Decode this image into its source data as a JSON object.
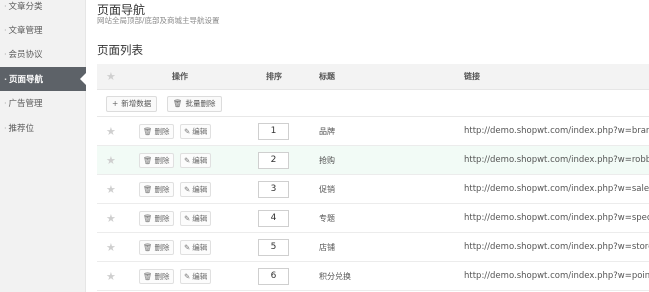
{
  "sidebar": {
    "items": [
      {
        "label": "文章分类"
      },
      {
        "label": "文章管理"
      },
      {
        "label": "会员协议"
      },
      {
        "label": "页面导航"
      },
      {
        "label": "广告管理"
      },
      {
        "label": "推荐位"
      }
    ],
    "active_index": 3,
    "bullet": "·"
  },
  "header": {
    "title": "页面导航",
    "subtitle": "网站全局顶部/底部及商城主导航设置"
  },
  "section": {
    "title": "页面列表"
  },
  "table": {
    "columns": {
      "star": "★",
      "actions": "操作",
      "sort": "排序",
      "title": "标题",
      "link": "链接"
    },
    "toolbar": {
      "add_label": "新增数据",
      "add_icon": "+",
      "batch_delete_label": "批量删除",
      "batch_delete_icon": "🗑"
    },
    "row_actions": {
      "delete_label": "删除",
      "delete_icon": "🗑",
      "edit_label": "编辑",
      "edit_icon": "✎"
    },
    "rows": [
      {
        "sort": "1",
        "title": "品牌",
        "link": "http://demo.shopwt.com/index.php?w=brand"
      },
      {
        "sort": "2",
        "title": "抢购",
        "link": "http://demo.shopwt.com/index.php?w=robbuy"
      },
      {
        "sort": "3",
        "title": "促销",
        "link": "http://demo.shopwt.com/index.php?w=sale"
      },
      {
        "sort": "4",
        "title": "专题",
        "link": "http://demo.shopwt.com/index.php?w=special"
      },
      {
        "sort": "5",
        "title": "店铺",
        "link": "http://demo.shopwt.com/index.php?w=store"
      },
      {
        "sort": "6",
        "title": "积分兑换",
        "link": "http://demo.shopwt.com/index.php?w=points"
      }
    ],
    "highlighted_row": 1
  },
  "colors": {
    "sidebar_bg": "#f2f2f2",
    "active_bg": "#5d6268",
    "highlight_row": "#f2fbf6",
    "star": "#cfcfcf"
  }
}
